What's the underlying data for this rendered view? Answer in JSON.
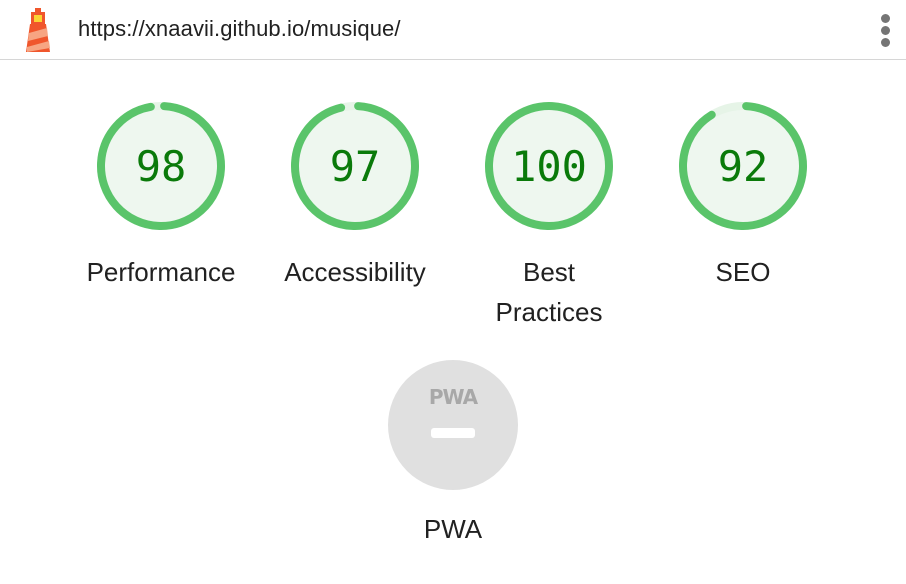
{
  "header": {
    "url": "https://xnaavii.github.io/musique/",
    "app_icon": "lighthouse-icon",
    "menu_icon": "more-vertical-icon"
  },
  "scores": [
    {
      "label": "Performance",
      "value": "98",
      "fraction": 0.98
    },
    {
      "label": "Accessibility",
      "value": "97",
      "fraction": 0.97
    },
    {
      "label": "Best Practices",
      "label_lines": [
        "Best",
        "Practices"
      ],
      "value": "100",
      "fraction": 1.0
    },
    {
      "label": "SEO",
      "value": "92",
      "fraction": 0.92
    }
  ],
  "pwa": {
    "badge_text": "PWA",
    "label": "PWA"
  },
  "colors": {
    "pass_stroke": "#5ac46a",
    "pass_fill": "#eef7ef",
    "pass_text": "#0a7a0a",
    "track": "#e6f4e7",
    "pwa_background": "#e0e0e0"
  }
}
